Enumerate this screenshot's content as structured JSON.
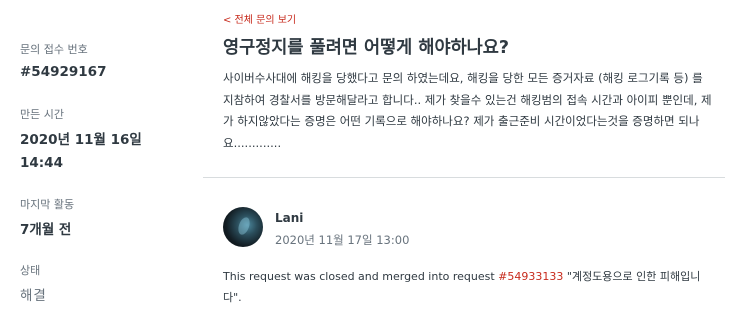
{
  "sidebar": {
    "request_id_label": "문의 접수 번호",
    "request_id": "#54929167",
    "created_label": "만든 시간",
    "created_date": "2020년 11월 16일",
    "created_time": "14:44",
    "last_activity_label": "마지막 활동",
    "last_activity": "7개월 전",
    "status_label": "상태",
    "status": "해결"
  },
  "main": {
    "back_link": "< 전체 문의 보기",
    "title": "영구정지를 풀려면 어떻게 해야하나요?",
    "body": "사이버수사대에 해킹을 당했다고 문의 하였는데요, 해킹을 당한 모든 증거자료 (해킹 로그기록 등) 를 지참하여 경찰서를 방문해달라고 합니다.. 제가 찾을수 있는건 해킹범의 접속 시간과 아이피 뿐인데, 제가 하지않았다는 증명은 어떤 기록으로 해야하나요? 제가 출근준비 시간이었다는것을 증명하면 되나요............."
  },
  "comment": {
    "author": "Lani",
    "timestamp": "2020년 11월 17일 13:00",
    "text_prefix": "This request was closed and merged into request ",
    "linked_request": "#54933133",
    "text_suffix": " \"계정도용으로 인한 피해입니다\"."
  },
  "colors": {
    "accent": "#c72a1c",
    "text": "#2f3941",
    "muted": "#68737d",
    "divider": "#d8dcde"
  }
}
